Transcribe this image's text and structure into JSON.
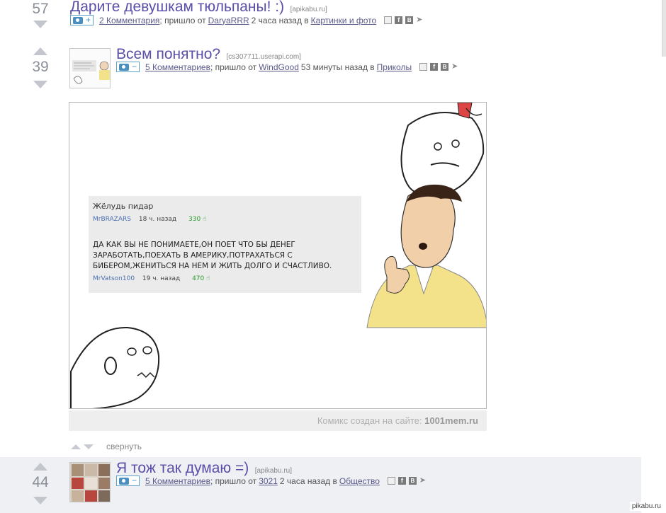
{
  "posts": [
    {
      "rating": "57",
      "title": "Дарите девушкам тюльпаны! :)",
      "domain": "[apikabu.ru]",
      "toggle_sign": "+",
      "comments": "2 Комментария",
      "from_text": "; пришло от",
      "author": "DaryaRRR",
      "time_text": "2 часа назад в",
      "category": "Картинки и фото"
    },
    {
      "rating": "39",
      "title": "Всем понятно?",
      "domain": "[cs307711.userapi.com]",
      "toggle_sign": "−",
      "comments": "5 Комментариев",
      "from_text": "; пришло от",
      "author": "WindGood",
      "time_text": "53 минуты назад в",
      "category": "Приколы"
    },
    {
      "rating": "44",
      "title": "Я тож так думаю =)",
      "domain": "[apikabu.ru]",
      "toggle_sign": "−",
      "comments": "5 Комментариев",
      "from_text": "; пришло от",
      "author": "3021",
      "time_text": "2 часа назад в",
      "category": "Общество"
    }
  ],
  "comic": {
    "comment_title": "Жёлудь пидар",
    "row1": {
      "user": "MrBRAZARS",
      "time": "18 ч. назад",
      "votes": "330"
    },
    "body": "ДА КАК ВЫ НЕ ПОНИМАЕТЕ,ОН ПОЕТ ЧТО БЫ ДЕНЕГ ЗАРАБОТАТЬ,ПОЕХАТЬ В АМЕРИКУ,ПОТРАХАТЬСЯ С БИБЕРОМ,ЖЕНИТЬСЯ НА НЕМ И ЖИТЬ ДОЛГО И СЧАСТЛИВО.",
    "row2": {
      "user": "MrVatson100",
      "time": "19 ч. назад",
      "votes": "470"
    },
    "credit_prefix": "Комикс создан на сайте:",
    "credit_site": "1001mem.ru"
  },
  "collapse_label": "свернуть",
  "watermark": "pikabu.ru",
  "icons": {
    "save": "save-icon",
    "fb": "f",
    "vk": "B",
    "tw": "twitter-icon"
  }
}
